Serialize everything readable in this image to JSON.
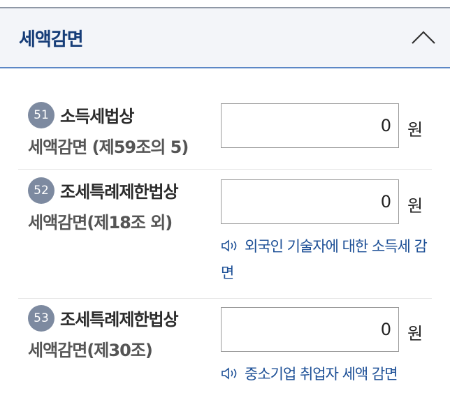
{
  "section": {
    "title": "세액감면"
  },
  "rows": [
    {
      "number": "51",
      "label_line1": "소득세법상",
      "label_line2": "세액감면 (제59조의 5)",
      "value": "0",
      "unit": "원"
    },
    {
      "number": "52",
      "label_line1": "조세특례제한법상",
      "label_line2": "세액감면(제18조 외)",
      "value": "0",
      "unit": "원",
      "help_link": "외국인 기술자에 대한 소득세 감면"
    },
    {
      "number": "53",
      "label_line1": "조세특례제한법상",
      "label_line2": "세액감면(제30조)",
      "value": "0",
      "unit": "원",
      "help_link": "중소기업 취업자 세액 감면"
    }
  ],
  "icons": {
    "collapse": "chevron-up-icon",
    "help": "speaker-icon"
  },
  "colors": {
    "title": "#163d78",
    "badge": "#7d8aa0",
    "link": "#1c4f96",
    "header_border": "#5c87c6"
  }
}
